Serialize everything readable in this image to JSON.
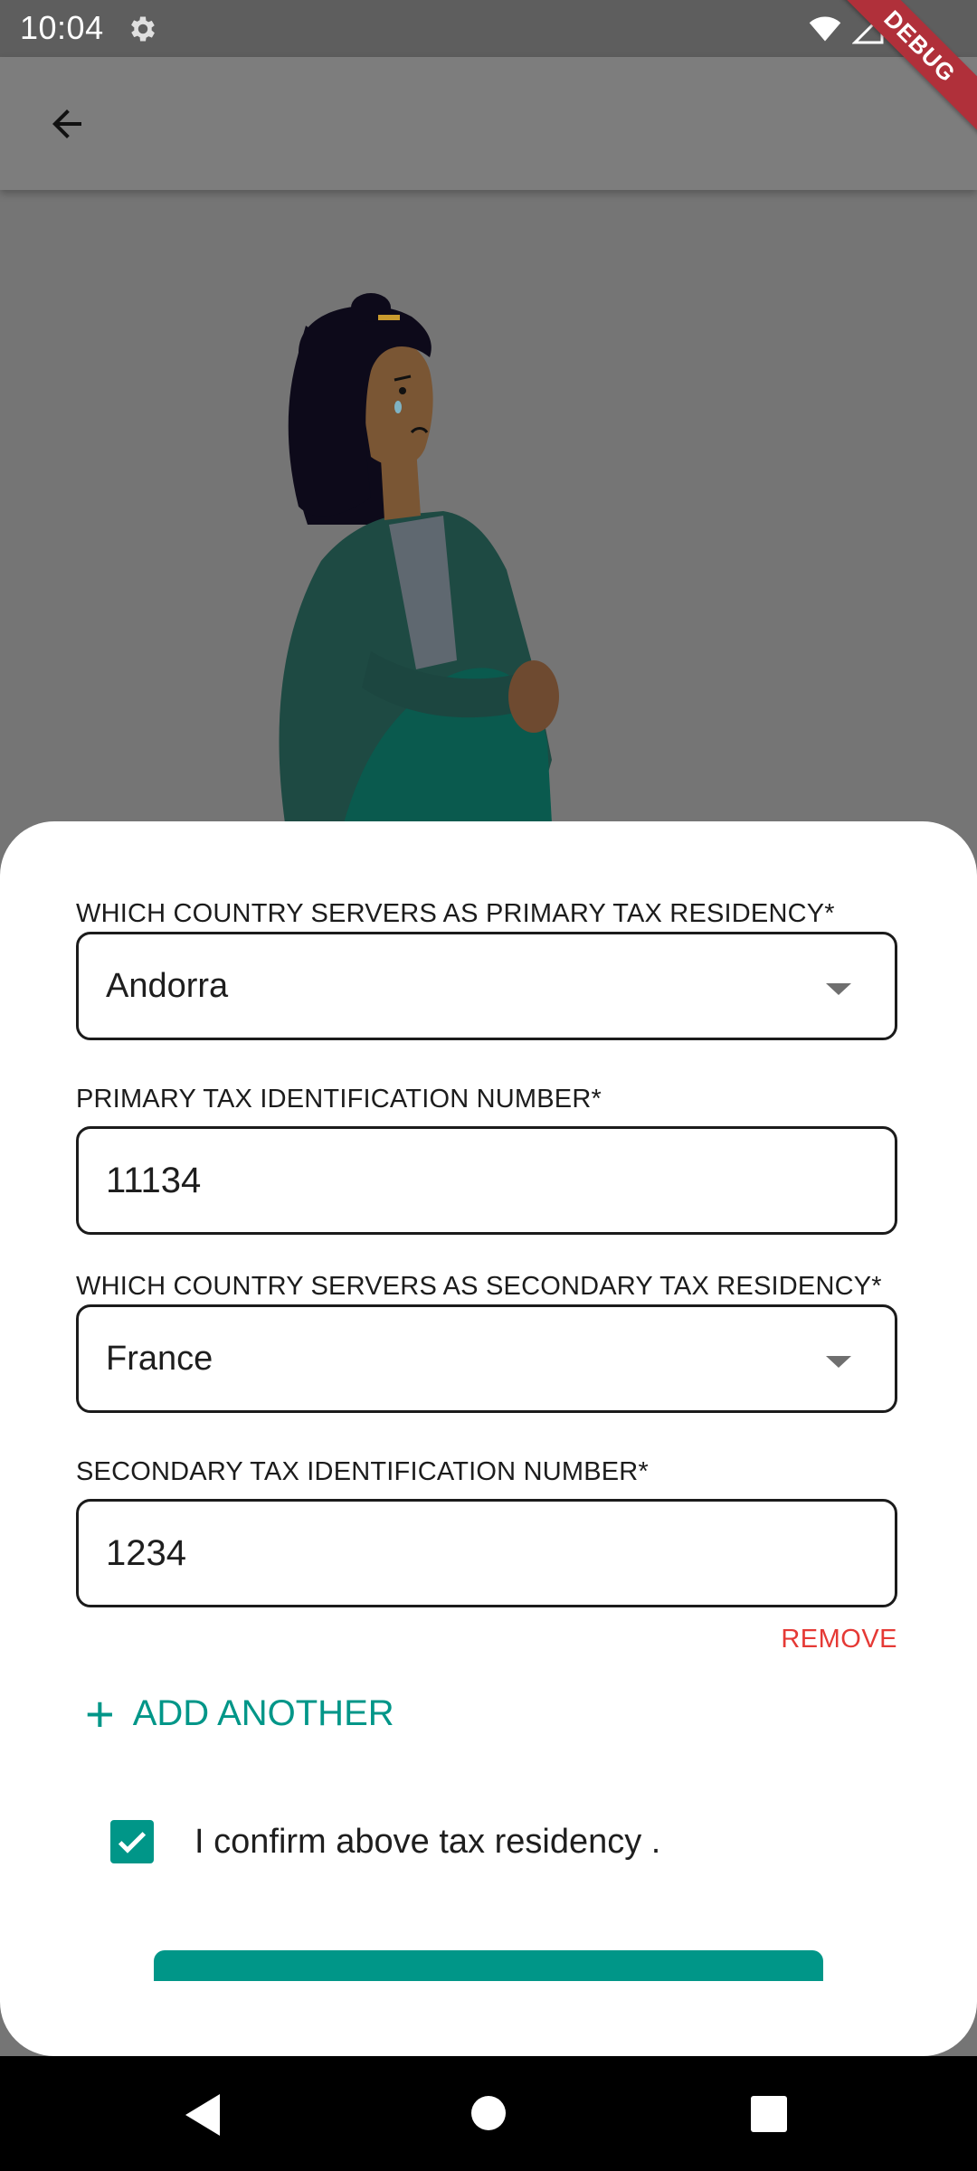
{
  "status_bar": {
    "time": "10:04",
    "icons": [
      "gear-icon",
      "wifi-icon",
      "signal-icon",
      "battery-icon"
    ]
  },
  "debug_banner": "DEBUG",
  "app_bar": {
    "back_icon": "arrow-back-icon"
  },
  "form": {
    "primary_country": {
      "label": "WHICH COUNTRY SERVERS AS PRIMARY TAX RESIDENCY*",
      "value": "Andorra"
    },
    "primary_tin": {
      "label": "PRIMARY TAX IDENTIFICATION NUMBER*",
      "value": "11134"
    },
    "secondary_country": {
      "label": "WHICH COUNTRY SERVERS AS SECONDARY TAX RESIDENCY*",
      "value": "France"
    },
    "secondary_tin": {
      "label": "SECONDARY TAX IDENTIFICATION NUMBER*",
      "value": "1234"
    },
    "remove_label": "REMOVE",
    "add_another_label": "ADD ANOTHER",
    "confirm_text": "I confirm above tax residency .",
    "confirm_checked": true
  },
  "colors": {
    "accent": "#009688",
    "remove": "#e53935",
    "scrim": "#757575"
  },
  "nav_bar": {
    "icons": [
      "nav-back-icon",
      "nav-home-icon",
      "nav-recents-icon"
    ]
  }
}
